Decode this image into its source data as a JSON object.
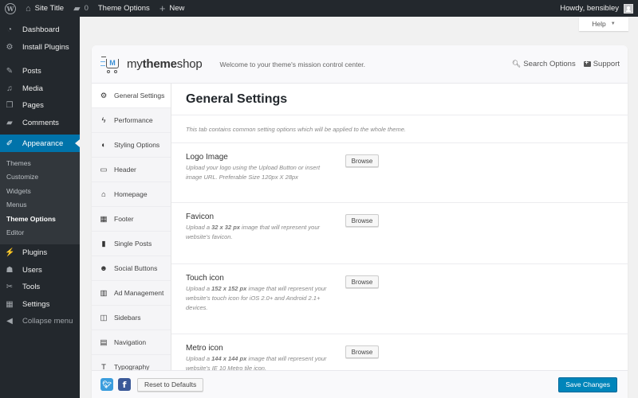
{
  "adminbar": {
    "site_title": "Site Title",
    "comments_count": "0",
    "theme_options": "Theme Options",
    "new_label": "New",
    "howdy": "Howdy, bensibley"
  },
  "help": {
    "label": "Help"
  },
  "sidebar": {
    "items": [
      {
        "label": "Dashboard",
        "icon": "dashboard-icon"
      },
      {
        "label": "Install Plugins",
        "icon": "gear-icon"
      },
      {
        "label": "Posts",
        "icon": "pin-icon"
      },
      {
        "label": "Media",
        "icon": "media-icon"
      },
      {
        "label": "Pages",
        "icon": "pages-icon"
      },
      {
        "label": "Comments",
        "icon": "comment-icon"
      },
      {
        "label": "Appearance",
        "icon": "paintbrush-icon"
      },
      {
        "label": "Plugins",
        "icon": "plugin-icon"
      },
      {
        "label": "Users",
        "icon": "user-icon"
      },
      {
        "label": "Tools",
        "icon": "wrench-icon"
      },
      {
        "label": "Settings",
        "icon": "settings-icon"
      },
      {
        "label": "Collapse menu",
        "icon": "collapse-icon"
      }
    ],
    "submenu": [
      "Themes",
      "Customize",
      "Widgets",
      "Menus",
      "Theme Options",
      "Editor"
    ],
    "active_item": "Appearance",
    "current_sub": "Theme Options"
  },
  "panel": {
    "brand_light": "my",
    "brand_bold": "theme",
    "brand_tail": "shop",
    "logo_letter": "M",
    "welcome": "Welcome to your theme's mission control center.",
    "search_options": "Search Options",
    "support": "Support",
    "tabs": [
      {
        "label": "General Settings",
        "icon": "gears-icon",
        "glyph": "⚙"
      },
      {
        "label": "Performance",
        "icon": "bolt-icon",
        "glyph": "ϟ"
      },
      {
        "label": "Styling Options",
        "icon": "contrast-icon",
        "glyph": "◐"
      },
      {
        "label": "Header",
        "icon": "header-icon",
        "glyph": "▭"
      },
      {
        "label": "Homepage",
        "icon": "home-icon",
        "glyph": "⌂"
      },
      {
        "label": "Footer",
        "icon": "table-icon",
        "glyph": "▦"
      },
      {
        "label": "Single Posts",
        "icon": "file-icon",
        "glyph": "▮"
      },
      {
        "label": "Social Buttons",
        "icon": "users-icon",
        "glyph": "☻"
      },
      {
        "label": "Ad Management",
        "icon": "bar-chart-icon",
        "glyph": "▥"
      },
      {
        "label": "Sidebars",
        "icon": "columns-icon",
        "glyph": "◫"
      },
      {
        "label": "Navigation",
        "icon": "list-alt-icon",
        "glyph": "▤"
      },
      {
        "label": "Typography",
        "icon": "text-icon",
        "glyph": "T"
      }
    ],
    "active_tab": "General Settings",
    "content": {
      "title": "General Settings",
      "description": "This tab contains common setting options which will be applied to the whole theme.",
      "options": [
        {
          "label": "Logo Image",
          "desc_parts": [
            "Upload your logo using the Upload Button or insert image URL. Preferable Size 120px X 28px"
          ],
          "button": "Browse"
        },
        {
          "label": "Favicon",
          "desc_parts": [
            "Upload a ",
            "32 x 32 px",
            " image that will represent your website's favicon."
          ],
          "button": "Browse"
        },
        {
          "label": "Touch icon",
          "desc_parts": [
            "Upload a ",
            "152 x 152 px",
            " image that will represent your website's touch icon for iOS 2.0+ and Android 2.1+ devices."
          ],
          "button": "Browse"
        },
        {
          "label": "Metro icon",
          "desc_parts": [
            "Upload a ",
            "144 x 144 px",
            " image that will represent your website's IE 10 Metro tile icon."
          ],
          "button": "Browse"
        }
      ]
    },
    "footer": {
      "reset": "Reset to Defaults",
      "save": "Save Changes"
    }
  },
  "colors": {
    "adminbar_bg": "#23282d",
    "active_menu": "#0073aa",
    "save_button": "#0085ba",
    "twitter": "#3b9ddd",
    "facebook": "#3b5998"
  }
}
